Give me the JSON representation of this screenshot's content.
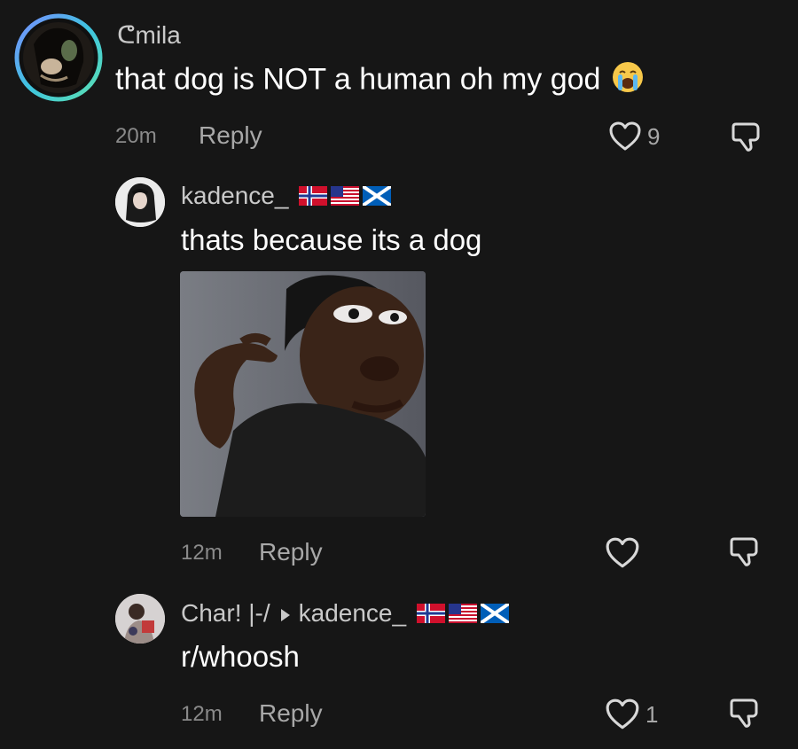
{
  "comments": [
    {
      "username": "ᕦmila",
      "text": "that dog is NOT a human oh my god",
      "emoji": "loudly-crying-face",
      "time": "20m",
      "reply_label": "Reply",
      "likes": "9"
    },
    {
      "username": "kadence_",
      "flags": [
        "norway-flag",
        "usa-flag",
        "scotland-flag"
      ],
      "text": "thats because its a dog",
      "attachment": "reaction-photo",
      "time": "12m",
      "reply_label": "Reply",
      "likes": ""
    },
    {
      "username": "Char! |-/",
      "reply_to": "kadence_",
      "reply_to_flags": [
        "norway-flag",
        "usa-flag",
        "scotland-flag"
      ],
      "text": "r/whoosh",
      "time": "12m",
      "reply_label": "Reply",
      "likes": "1"
    }
  ],
  "colors": {
    "background": "#161616",
    "username": "#c9c9c9",
    "text": "#ffffff",
    "meta": "#8a8a8a",
    "icon": "#d8d8d8",
    "avatar_ring": "#3ec4e0"
  },
  "icons": [
    "heart-icon",
    "dislike-icon",
    "caret-right-icon"
  ]
}
